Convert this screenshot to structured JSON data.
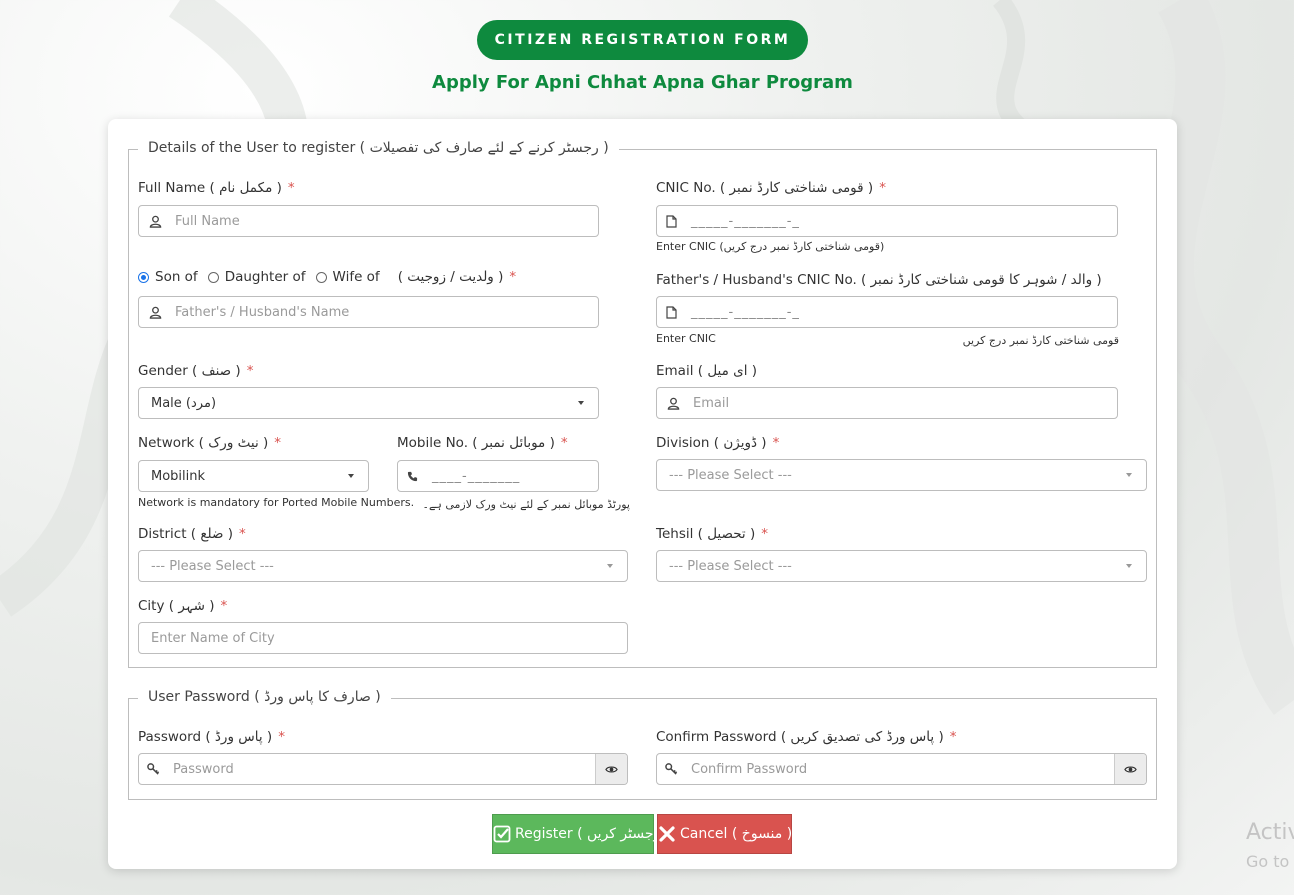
{
  "header": {
    "title": "CITIZEN REGISTRATION FORM",
    "subtitle": "Apply For Apni Chhat Apna Ghar Program"
  },
  "user_details": {
    "legend": "Details of the User to register ( رجسٹر کرنے کے لئے صارف کی تفصیلات )",
    "full_name": {
      "label": "Full Name ( مکمل نام )",
      "placeholder": "Full Name",
      "icon": "user-icon"
    },
    "cnic": {
      "label": "CNIC No. ( قومی شناختی کارڈ نمبر )",
      "mask": "_____-_______-_",
      "hint": "Enter CNIC (قومی شناختی کارڈ نمبر درج کریں)",
      "icon": "id-card-icon"
    },
    "relation": {
      "options": [
        "Son of",
        "Daughter of",
        "Wife of"
      ],
      "selected": "Son of",
      "urdu_label": "( ولدیت / زوجیت )",
      "placeholder": "Father's / Husband's Name"
    },
    "father_cnic": {
      "label": "Father's / Husband's CNIC No. ( والد / شوہر کا قومی شناختی کارڈ نمبر )",
      "mask": "_____-_______-_",
      "hint_en": "Enter CNIC",
      "hint_ur": "قومی شناختی کارڈ نمبر درج کریں"
    },
    "gender": {
      "label": "Gender ( صنف )",
      "value": "Male (مرد)"
    },
    "email": {
      "label": "Email ( ای میل )",
      "placeholder": "Email"
    },
    "network": {
      "label": "Network ( نیٹ ورک )",
      "value": "Mobilink",
      "hint": "Network is mandatory for Ported Mobile Numbers."
    },
    "mobile": {
      "label": "Mobile No. ( موبائل نمبر )",
      "mask": "____-_______",
      "hint_ur": "پورٹڈ موبائل نمبر کے لئے نیٹ ورک لازمی ہے۔"
    },
    "division": {
      "label": "Division ( ڈویژن )",
      "value": "--- Please Select ---"
    },
    "district": {
      "label": "District ( ضلع )",
      "value": "--- Please Select ---"
    },
    "tehsil": {
      "label": "Tehsil ( تحصیل )",
      "value": "--- Please Select ---"
    },
    "city": {
      "label": "City ( شہر )",
      "placeholder": "Enter Name of City"
    }
  },
  "password_section": {
    "legend": "User Password ( صارف کا پاس ورڈ )",
    "password": {
      "label": "Password ( پاس ورڈ )",
      "placeholder": "Password"
    },
    "confirm": {
      "label": "Confirm Password ( پاس ورڈ کی تصدیق کریں )",
      "placeholder": "Confirm Password"
    }
  },
  "actions": {
    "register": "Register ( رجسٹر کریں )",
    "cancel": "Cancel ( منسوخ )"
  },
  "watermark": {
    "line1": "Activ",
    "line2": "Go to"
  },
  "colors": {
    "brand_green": "#0e8a3e",
    "required": "#d9534f",
    "button_green": "#5cb85c",
    "button_red": "#d9534f"
  }
}
